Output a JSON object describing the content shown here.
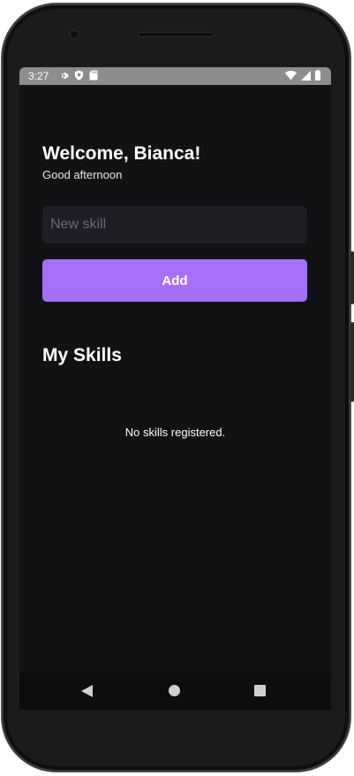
{
  "status_bar": {
    "time": "3:27",
    "icons": [
      "gear-icon",
      "shield-icon",
      "sd-card-icon",
      "wifi-icon",
      "signal-icon",
      "battery-icon"
    ]
  },
  "header": {
    "title": "Welcome, Bianca!",
    "greeting": "Good afternoon"
  },
  "form": {
    "input_value": "",
    "input_placeholder": "New skill",
    "add_label": "Add"
  },
  "skills": {
    "section_title": "My Skills",
    "items": [],
    "empty_message": "No skills registered."
  },
  "nav_bar": {
    "icons": [
      "back-icon",
      "home-icon",
      "recents-icon"
    ]
  },
  "colors": {
    "background": "#121214",
    "input_background": "#1e1e24",
    "accent": "#a370f7",
    "status_bar": "#8d8d8d"
  }
}
